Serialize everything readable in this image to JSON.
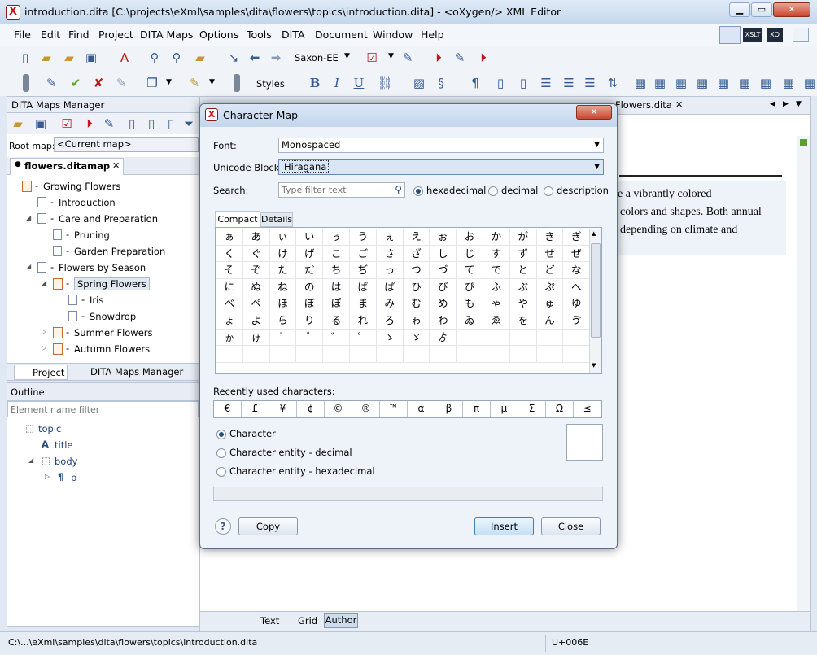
{
  "window": {
    "title": "introduction.dita [C:\\projects\\eXml\\samples\\dita\\flowers\\topics\\introduction.dita] - <oXygen/> XML Editor",
    "app_icon": "X"
  },
  "menu": [
    "File",
    "Edit",
    "Find",
    "Project",
    "DITA Maps",
    "Options",
    "Tools",
    "DITA",
    "Document",
    "Window",
    "Help"
  ],
  "toolbar": {
    "transform": "Saxon-EE",
    "styles": "Styles",
    "perspectives": [
      "XSLT",
      "XQ"
    ]
  },
  "maps_manager": {
    "title": "DITA Maps Manager",
    "root_map_label": "Root map:",
    "root_map_value": "<Current map>",
    "tab": "flowers.ditamap",
    "tree": [
      {
        "label": "Growing Flowers",
        "level": 0,
        "kind": "map",
        "tri": ""
      },
      {
        "label": "Introduction",
        "level": 1,
        "kind": "doc",
        "tri": ""
      },
      {
        "label": "Care and Preparation",
        "level": 1,
        "kind": "doc",
        "tri": "◢"
      },
      {
        "label": "Pruning",
        "level": 2,
        "kind": "doc",
        "tri": ""
      },
      {
        "label": "Garden Preparation",
        "level": 2,
        "kind": "doc",
        "tri": ""
      },
      {
        "label": "Flowers by Season",
        "level": 1,
        "kind": "doc",
        "tri": "◢"
      },
      {
        "label": "Spring Flowers",
        "level": 2,
        "kind": "map",
        "tri": "◢",
        "selected": true
      },
      {
        "label": "Iris",
        "level": 3,
        "kind": "doc",
        "tri": ""
      },
      {
        "label": "Snowdrop",
        "level": 3,
        "kind": "doc",
        "tri": ""
      },
      {
        "label": "Summer Flowers",
        "level": 2,
        "kind": "map",
        "tri": "▷"
      },
      {
        "label": "Autumn Flowers",
        "level": 2,
        "kind": "map",
        "tri": "▷"
      }
    ],
    "bottom_tabs": [
      "Project",
      "DITA Maps Manager"
    ]
  },
  "outline": {
    "title": "Outline",
    "filter_placeholder": "Element name filter",
    "tree": [
      {
        "label": "topic",
        "level": 0,
        "icon": "⬚"
      },
      {
        "label": "title",
        "level": 1,
        "icon": "A"
      },
      {
        "label": "body",
        "level": 1,
        "icon": "⬚",
        "tri": "◢"
      },
      {
        "label": "p",
        "level": 2,
        "icon": "¶",
        "tri": "▷"
      }
    ]
  },
  "editor": {
    "tab": "Flowers.dita",
    "text_lines": [
      "e a vibrantly colored",
      "colors and shapes. Both annual",
      "depending on climate and"
    ],
    "mode_tabs": [
      "Text",
      "Grid",
      "Author"
    ],
    "active_mode": "Author"
  },
  "status": {
    "path": "C:\\...\\eXml\\samples\\dita\\flowers\\topics\\introduction.dita",
    "char": "U+006E"
  },
  "dialog": {
    "title": "Character Map",
    "font_label": "Font:",
    "font_value": "Monospaced",
    "block_label": "Unicode Block:",
    "block_value": "Hiragana",
    "search_label": "Search:",
    "search_placeholder": "Type filter text",
    "search_modes": [
      "hexadecimal",
      "decimal",
      "description"
    ],
    "tabs": [
      "Compact",
      "Details"
    ],
    "chars": [
      "ぁ",
      "あ",
      "ぃ",
      "い",
      "ぅ",
      "う",
      "ぇ",
      "え",
      "ぉ",
      "お",
      "か",
      "が",
      "き",
      "ぎ",
      "く",
      "ぐ",
      "け",
      "げ",
      "こ",
      "ご",
      "さ",
      "ざ",
      "し",
      "じ",
      "す",
      "ず",
      "せ",
      "ぜ",
      "そ",
      "ぞ",
      "た",
      "だ",
      "ち",
      "ぢ",
      "っ",
      "つ",
      "づ",
      "て",
      "で",
      "と",
      "ど",
      "な",
      "に",
      "ぬ",
      "ね",
      "の",
      "は",
      "ば",
      "ぱ",
      "ひ",
      "び",
      "ぴ",
      "ふ",
      "ぶ",
      "ぷ",
      "へ",
      "べ",
      "ぺ",
      "ほ",
      "ぼ",
      "ぽ",
      "ま",
      "み",
      "む",
      "め",
      "も",
      "ゃ",
      "や",
      "ゅ",
      "ゆ",
      "ょ",
      "よ",
      "ら",
      "り",
      "る",
      "れ",
      "ろ",
      "ゎ",
      "わ",
      "ゐ",
      "ゑ",
      "を",
      "ん",
      "ゔ",
      "ゕ",
      "ゖ",
      "゙",
      "゚",
      "゛",
      "゜",
      "ゝ",
      "ゞ",
      "ゟ"
    ],
    "recent_label": "Recently used characters:",
    "recent": [
      "€",
      "£",
      "¥",
      "¢",
      "©",
      "®",
      "™",
      "α",
      "β",
      "π",
      "μ",
      "Σ",
      "Ω",
      "≤"
    ],
    "output_options": [
      "Character",
      "Character entity - decimal",
      "Character entity - hexadecimal"
    ],
    "buttons": {
      "help": "?",
      "copy": "Copy",
      "insert": "Insert",
      "close": "Close"
    }
  }
}
